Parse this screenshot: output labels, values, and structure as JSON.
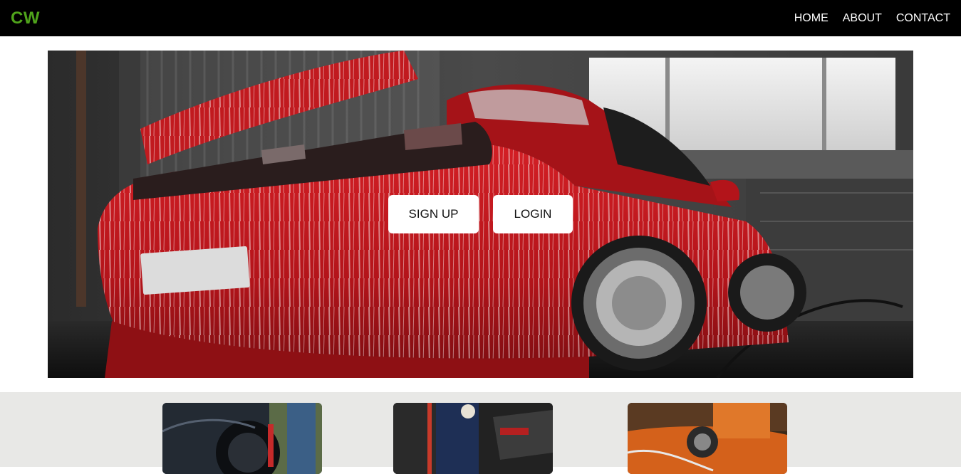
{
  "navbar": {
    "logo": "CW",
    "links": [
      {
        "label": "HOME"
      },
      {
        "label": "ABOUT"
      },
      {
        "label": "CONTACT"
      }
    ]
  },
  "hero": {
    "image": "red-car-foam-wash-image",
    "buttons": {
      "signup": "SIGN UP",
      "login": "LOGIN"
    }
  },
  "services": {
    "cards": [
      {
        "image": "dark-car-wheel-image"
      },
      {
        "image": "car-interior-cleaning-image"
      },
      {
        "image": "orange-car-polishing-image"
      }
    ]
  },
  "colors": {
    "navbar_bg": "#000000",
    "logo": "#4fa31b",
    "services_bg": "#e8e8e6",
    "car_red": "#c0161c"
  }
}
